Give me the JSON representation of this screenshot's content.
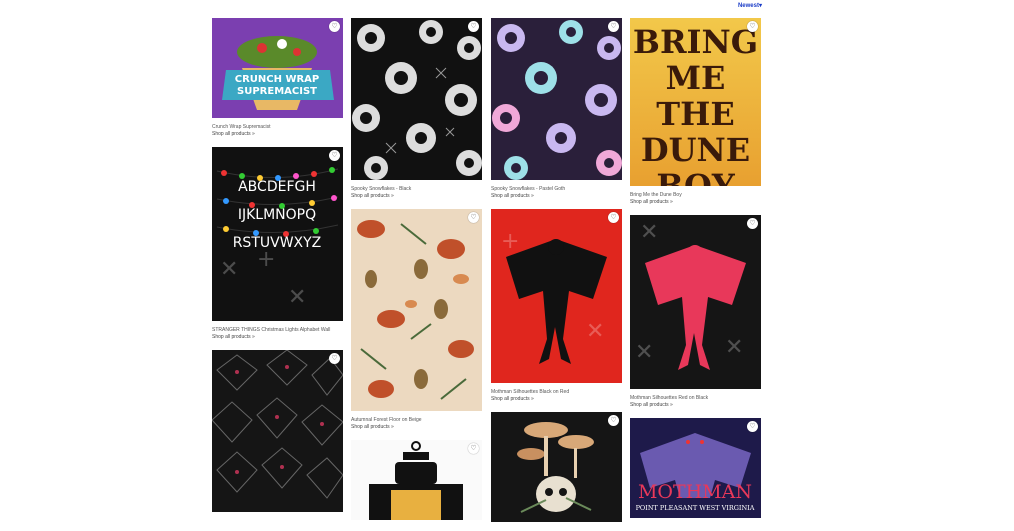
{
  "sort": {
    "label": "Newest"
  },
  "shop_link": "Shop all products",
  "icons": {
    "heart": "heart-icon",
    "chevron": "chevron-down-icon"
  },
  "cards": {
    "crunch": {
      "title": "Crunch Wrap Supremacist",
      "art_text": "CRUNCH WRAP SUPREMACIST"
    },
    "stranger": {
      "title": "STRANGER THINGS Christmas Lights Alphabet Wall",
      "rows": [
        "ABCDEFGH",
        "IJKLMNOPQ",
        "RSTUVWXYZ"
      ]
    },
    "mothpattern": {
      "title": ""
    },
    "snowblack": {
      "title": "Spooky Snowflakes - Black"
    },
    "forest": {
      "title": "Autumnal Forest Floor on Beige"
    },
    "lantern": {
      "title": ""
    },
    "snowgoth": {
      "title": "Spooky Snowflakes - Pastel Goth"
    },
    "mothred": {
      "title": "Mothman Silhouettes Black on Red"
    },
    "mushroom": {
      "title": ""
    },
    "dune": {
      "title": "Bring Me the Dune Boy",
      "art_lines": [
        "BRING",
        "ME THE",
        "DUNE",
        "BOY"
      ]
    },
    "mothblack": {
      "title": "Mothman Silhouettes Red on Black"
    },
    "mothman": {
      "title": "",
      "art_title": "MOTHMAN",
      "art_sub": "POINT PLEASANT WEST VIRGINIA"
    }
  }
}
